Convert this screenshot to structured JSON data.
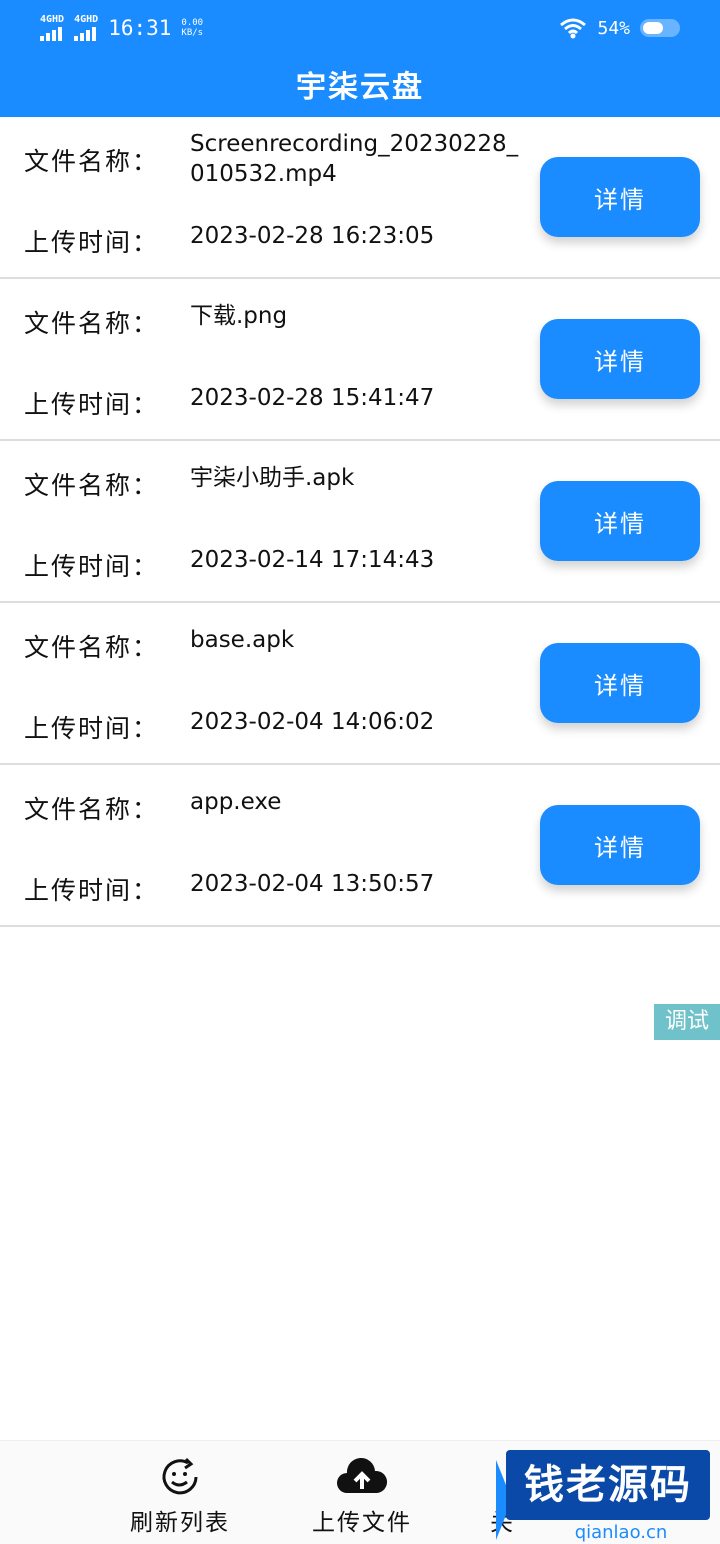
{
  "status_bar": {
    "sim1_label": "4GHD",
    "sim2_label": "4GHD",
    "time": "16:31",
    "speed_value": "0.00",
    "speed_unit": "KB/s",
    "battery_text": "54%"
  },
  "header": {
    "title": "宇柒云盘"
  },
  "labels": {
    "file_name": "文件名称：",
    "upload_time": "上传时间：",
    "detail_button": "详情"
  },
  "files": [
    {
      "name": "Screenrecording_20230228_010532.mp4",
      "time": "2023-02-28 16:23:05"
    },
    {
      "name": "下载.png",
      "time": "2023-02-28 15:41:47"
    },
    {
      "name": "宇柒小助手.apk",
      "time": "2023-02-14 17:14:43"
    },
    {
      "name": "base.apk",
      "time": "2023-02-04 14:06:02"
    },
    {
      "name": "app.exe",
      "time": "2023-02-04 13:50:57"
    }
  ],
  "debug_tag": "调试",
  "bottom_nav": [
    {
      "label": "刷新列表",
      "icon": "refresh-smile-icon"
    },
    {
      "label": "上传文件",
      "icon": "cloud-upload-icon"
    },
    {
      "label": "关",
      "icon": ""
    }
  ],
  "watermark": {
    "title": "钱老源码",
    "subtitle": "qianlao.cn"
  },
  "colors": {
    "primary": "#1a8cff",
    "divider": "#dddddd",
    "debug_tag": "#6fc2c9",
    "watermark_bg": "#0a49a8"
  }
}
